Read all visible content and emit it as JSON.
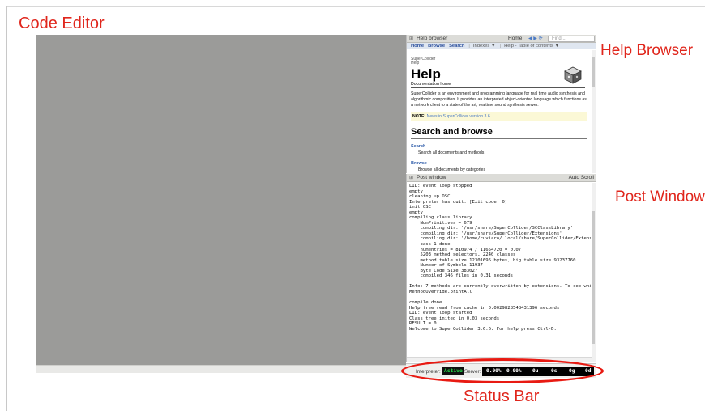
{
  "annotations": {
    "code_editor": "Code Editor",
    "help_browser": "Help Browser",
    "post_window": "Post Window",
    "status_bar": "Status Bar"
  },
  "colors": {
    "annotation": "#e0261c",
    "editor_background": "#9b9b99",
    "status_ellipse": "#e81a12",
    "active_indicator": "#22e04a"
  },
  "help_browser": {
    "title": "Help browser",
    "home_label": "Home",
    "find_placeholder": "Find...",
    "tabs": [
      {
        "label": "Home"
      },
      {
        "label": "Browse"
      },
      {
        "label": "Search"
      },
      {
        "label": "Indexes ▼"
      },
      {
        "label": "Help - Table of contents ▼"
      }
    ],
    "breadcrumb_top": "SuperCollider",
    "breadcrumb_sub": "Help",
    "heading": "Help",
    "subtitle": "Documentation home",
    "paragraph": "SuperCollider is an environment and programming language for real time audio synthesis and algorithmic composition. It provides an interpreted object-oriented language which functions as a network client to a state of the art, realtime sound synthesis server.",
    "note_label": "NOTE:",
    "note_text": "News in SuperCollider version 3.6",
    "section_heading": "Search and browse",
    "links": [
      {
        "title": "Search",
        "description": "Search all documents and methods"
      },
      {
        "title": "Browse",
        "description": "Browse all documents by categories"
      }
    ]
  },
  "post_window": {
    "title": "Post window",
    "autoscroll_label": "Auto Scroll",
    "lines": [
      "LID: event loop stopped",
      "empty",
      "cleaning up OSC",
      "Interpreter has quit. [Exit code: 0]",
      "init OSC",
      "empty",
      "compiling class library...",
      "    NumPrimitives = 679",
      "    compiling dir: '/usr/share/SuperCollider/SCClassLibrary'",
      "    compiling dir: '/usr/share/SuperCollider/Extensions'",
      "    compiling dir: '/home/ruviaro/.local/share/SuperCollider/Extensions'",
      "    pass 1 done",
      "    numentries = 810974 / 11654720 = 0.07",
      "    5203 method selectors, 2240 classes",
      "    method table size 12301696 bytes, big table size 93237760",
      "    Number of Symbols 11937",
      "    Byte Code Size 383027",
      "    compiled 346 files in 0.31 seconds",
      "",
      "Info: 7 methods are currently overwritten by extensions. To see which, execute:",
      "MethodOverride.printAll",
      "",
      "compile done",
      "Help tree read from cache in 0.0029828548431396 seconds",
      "LID: event loop started",
      "Class tree inited in 0.03 seconds",
      "RESULT = 0",
      "Welcome to SuperCollider 3.6.6. For help press Ctrl-D."
    ]
  },
  "status_bar": {
    "interpreter_label": "Interpreter:",
    "interpreter_state": "Active",
    "server_label": "Server:",
    "meters": [
      "0.00%",
      "0.00%",
      "0u",
      "0s",
      "0g",
      "0d"
    ]
  }
}
